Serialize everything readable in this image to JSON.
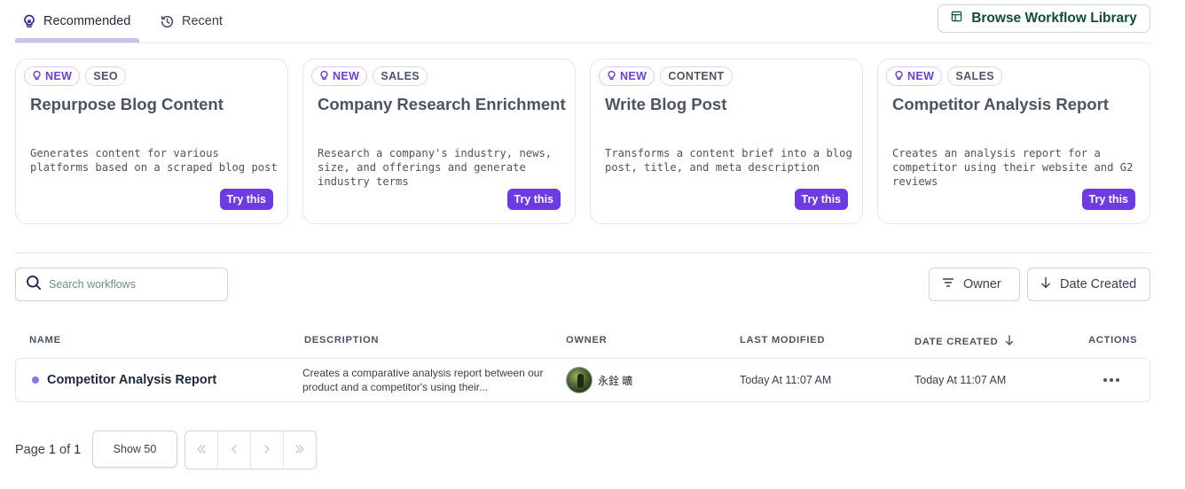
{
  "tabs": [
    {
      "label": "Recommended",
      "icon": "lightbulb-icon",
      "active": true
    },
    {
      "label": "Recent",
      "icon": "history-icon",
      "active": false
    }
  ],
  "browse_button": {
    "label": "Browse Workflow Library",
    "icon": "library-icon"
  },
  "cards": [
    {
      "badges": [
        "NEW",
        "SEO"
      ],
      "title": "Repurpose Blog Content",
      "description": "Generates content for various platforms based on a scraped blog post",
      "button": "Try this"
    },
    {
      "badges": [
        "NEW",
        "SALES"
      ],
      "title": "Company Research Enrichment",
      "description": "Research a company's industry, news, size, and offerings and generate industry terms",
      "button": "Try this"
    },
    {
      "badges": [
        "NEW",
        "CONTENT"
      ],
      "title": "Write Blog Post",
      "description": "Transforms a content brief into a blog post, title, and meta description",
      "button": "Try this"
    },
    {
      "badges": [
        "NEW",
        "SALES"
      ],
      "title": "Competitor Analysis Report",
      "description": "Creates an analysis report for a competitor using their website and G2 reviews",
      "button": "Try this"
    }
  ],
  "search": {
    "placeholder": "Search workflows",
    "value": ""
  },
  "filters": {
    "owner": "Owner",
    "date_created": "Date Created"
  },
  "table": {
    "headers": {
      "name": "NAME",
      "description": "DESCRIPTION",
      "owner": "OWNER",
      "last_modified": "LAST MODIFIED",
      "date_created": "DATE CREATED",
      "actions": "ACTIONS"
    },
    "rows": [
      {
        "name": "Competitor Analysis Report",
        "description": "Creates a comparative analysis report between our product and a competitor's using their...",
        "owner": "永銓 曠",
        "last_modified": "Today At 11:07 AM",
        "date_created": "Today At 11:07 AM"
      }
    ]
  },
  "pagination": {
    "page_prefix": "Page",
    "current": "1",
    "of_label": "of",
    "total": "1",
    "show_label": "Show 50"
  },
  "colors": {
    "accent": "#6d3be3",
    "tab_underline": "#c7c2ef",
    "browse_text": "#0f4c3f"
  }
}
